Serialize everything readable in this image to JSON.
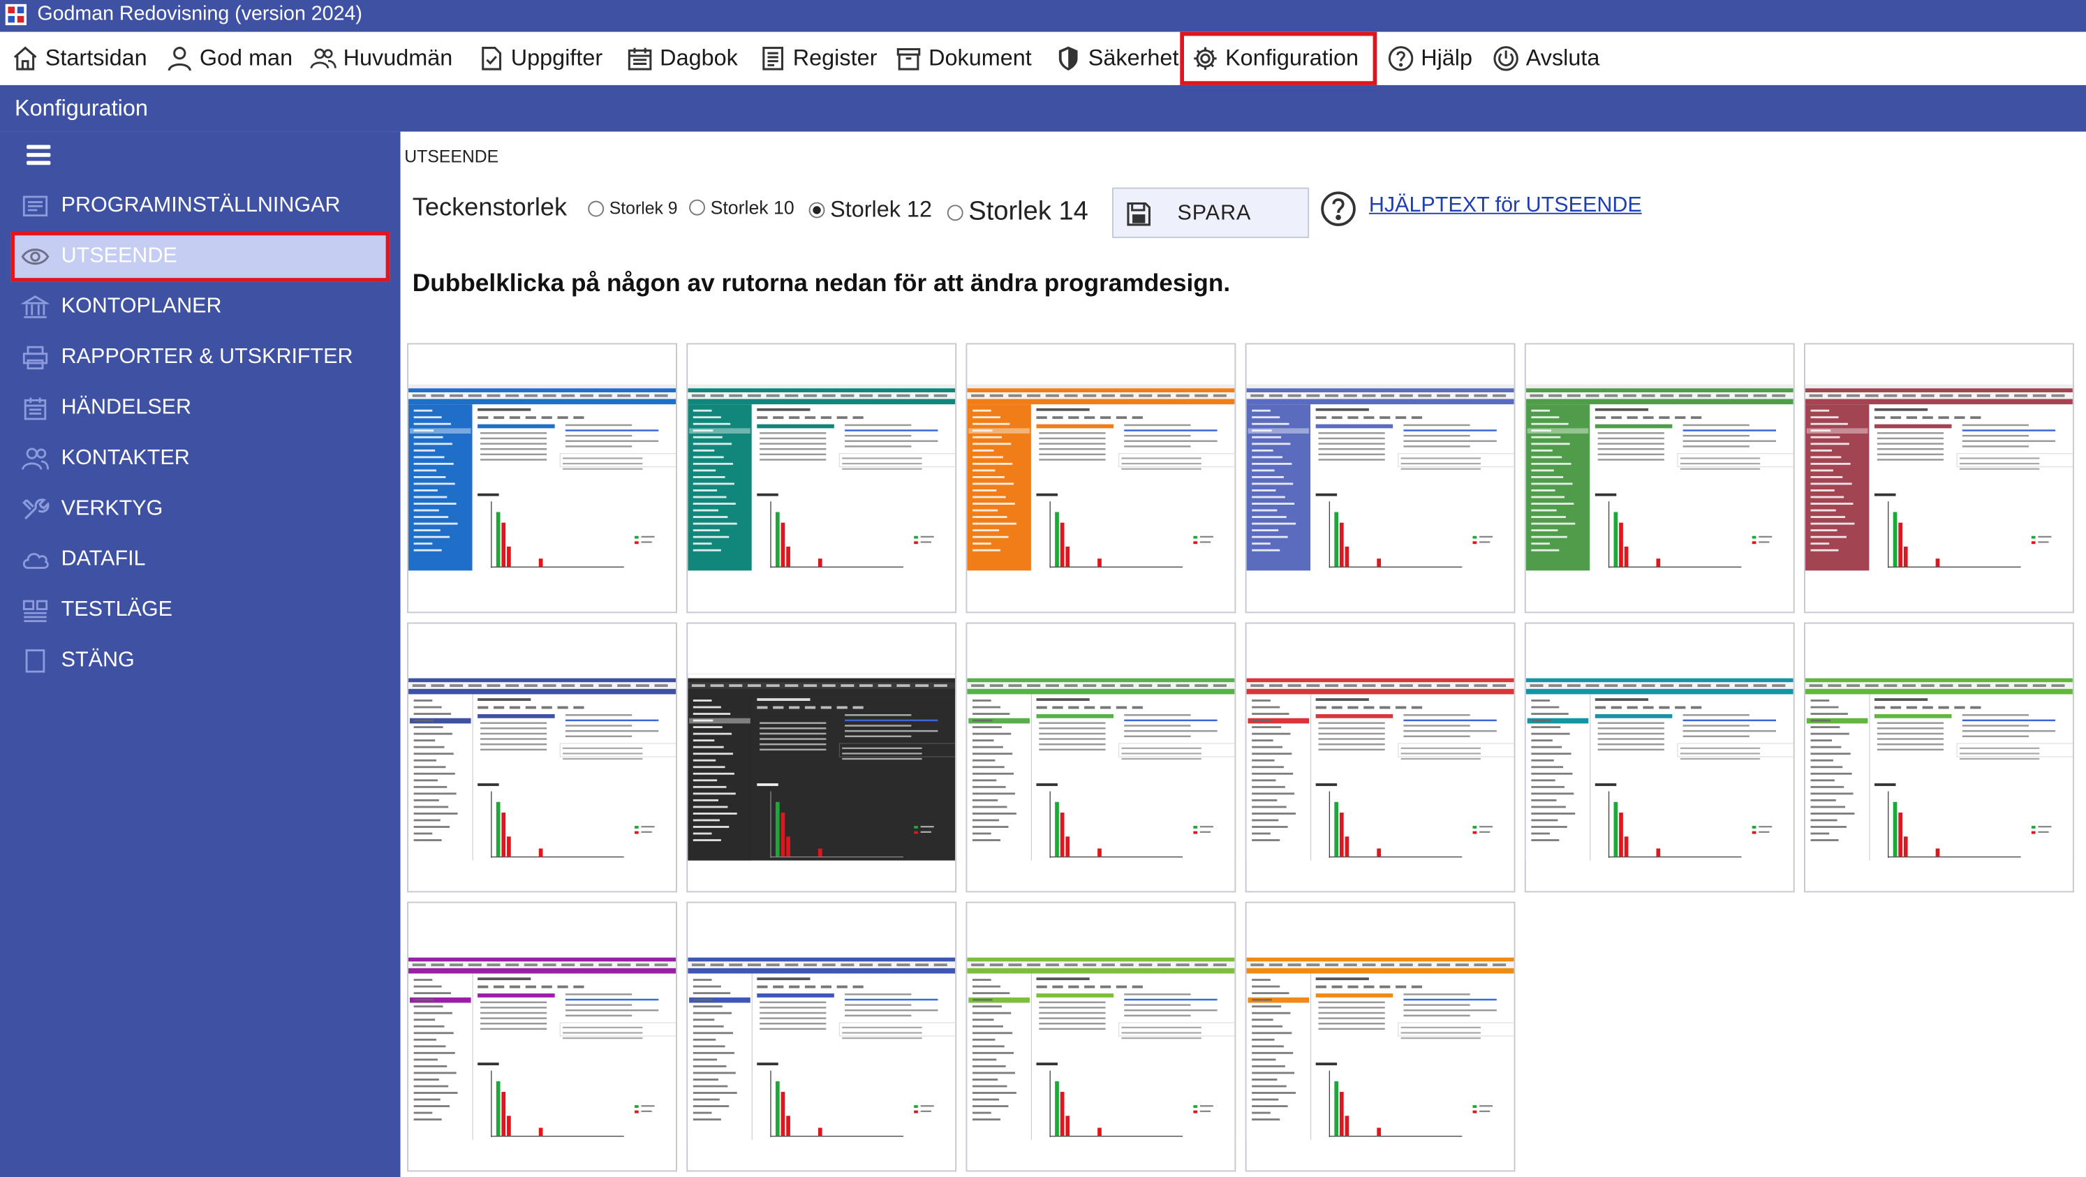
{
  "window": {
    "title": "Godman Redovisning (version 2024)"
  },
  "menu": [
    {
      "label": "Startsidan",
      "icon": "home-icon",
      "active": false
    },
    {
      "label": "God man",
      "icon": "user-icon",
      "active": false
    },
    {
      "label": "Huvudmän",
      "icon": "users-icon",
      "active": false
    },
    {
      "label": "Uppgifter",
      "icon": "task-icon",
      "active": false
    },
    {
      "label": "Dagbok",
      "icon": "calendar-icon",
      "active": false
    },
    {
      "label": "Register",
      "icon": "register-icon",
      "active": false
    },
    {
      "label": "Dokument",
      "icon": "archive-icon",
      "active": false
    },
    {
      "label": "Säkerhet",
      "icon": "shield-icon",
      "active": false
    },
    {
      "label": "Konfiguration",
      "icon": "gear-icon",
      "active": true
    },
    {
      "label": "Hjälp",
      "icon": "help-icon",
      "active": false
    },
    {
      "label": "Avsluta",
      "icon": "power-icon",
      "active": false
    }
  ],
  "section": {
    "title": "Konfiguration"
  },
  "sidebar": {
    "items": [
      {
        "label": "PROGRAMINSTÄLLNINGAR",
        "icon": "settings-list-icon",
        "active": false
      },
      {
        "label": "UTSEENDE",
        "icon": "eye-icon",
        "active": true
      },
      {
        "label": "KONTOPLANER",
        "icon": "bank-icon",
        "active": false
      },
      {
        "label": "RAPPORTER & UTSKRIFTER",
        "icon": "printer-icon",
        "active": false
      },
      {
        "label": "HÄNDELSER",
        "icon": "events-icon",
        "active": false
      },
      {
        "label": "KONTAKTER",
        "icon": "contacts-icon",
        "active": false
      },
      {
        "label": "VERKTYG",
        "icon": "tools-icon",
        "active": false
      },
      {
        "label": "DATAFIL",
        "icon": "cloud-icon",
        "active": false
      },
      {
        "label": "TESTLÄGE",
        "icon": "test-icon",
        "active": false
      },
      {
        "label": "STÄNG",
        "icon": "close-page-icon",
        "active": false
      }
    ]
  },
  "main": {
    "breadcrumb": "UTSEENDE",
    "font_size": {
      "label": "Teckenstorlek",
      "options": [
        "Storlek 9",
        "Storlek 10",
        "Storlek 12",
        "Storlek 14"
      ],
      "selected": "Storlek 12"
    },
    "save_label": "SPARA",
    "help_link": "HJÄLPTEXT för UTSEENDE",
    "instruction": "Dubbelklicka på någon av rutorna nedan för att ändra programdesign."
  },
  "themes": [
    {
      "accent": "#1f6fc9",
      "sidebar": "#1f6fc9",
      "style": "dark-sidebar"
    },
    {
      "accent": "#11867a",
      "sidebar": "#11867a",
      "style": "dark-sidebar"
    },
    {
      "accent": "#f07d18",
      "sidebar": "#f07d18",
      "style": "dark-sidebar"
    },
    {
      "accent": "#5b6bbd",
      "sidebar": "#5b6bbd",
      "style": "dark-sidebar"
    },
    {
      "accent": "#4f9d4a",
      "sidebar": "#4f9d4a",
      "style": "dark-sidebar"
    },
    {
      "accent": "#a24452",
      "sidebar": "#a24452",
      "style": "dark-sidebar"
    },
    {
      "accent": "#3f51a3",
      "sidebar": "#ffffff",
      "style": "light-sidebar"
    },
    {
      "accent": "#2a2a2a",
      "sidebar": "#2a2a2a",
      "style": "dark"
    },
    {
      "accent": "#58b04a",
      "sidebar": "#ffffff",
      "style": "light-sidebar"
    },
    {
      "accent": "#d8363b",
      "sidebar": "#ffffff",
      "style": "light-sidebar"
    },
    {
      "accent": "#1794a3",
      "sidebar": "#ffffff",
      "style": "light-sidebar"
    },
    {
      "accent": "#62b53d",
      "sidebar": "#ffffff",
      "style": "light-sidebar"
    },
    {
      "accent": "#9a1ea8",
      "sidebar": "#ffffff",
      "style": "light-sidebar"
    },
    {
      "accent": "#3e56b8",
      "sidebar": "#ffffff",
      "style": "light-sidebar"
    },
    {
      "accent": "#7bbf3a",
      "sidebar": "#ffffff",
      "style": "light-sidebar"
    },
    {
      "accent": "#f08a14",
      "sidebar": "#ffffff",
      "style": "light-sidebar"
    }
  ]
}
